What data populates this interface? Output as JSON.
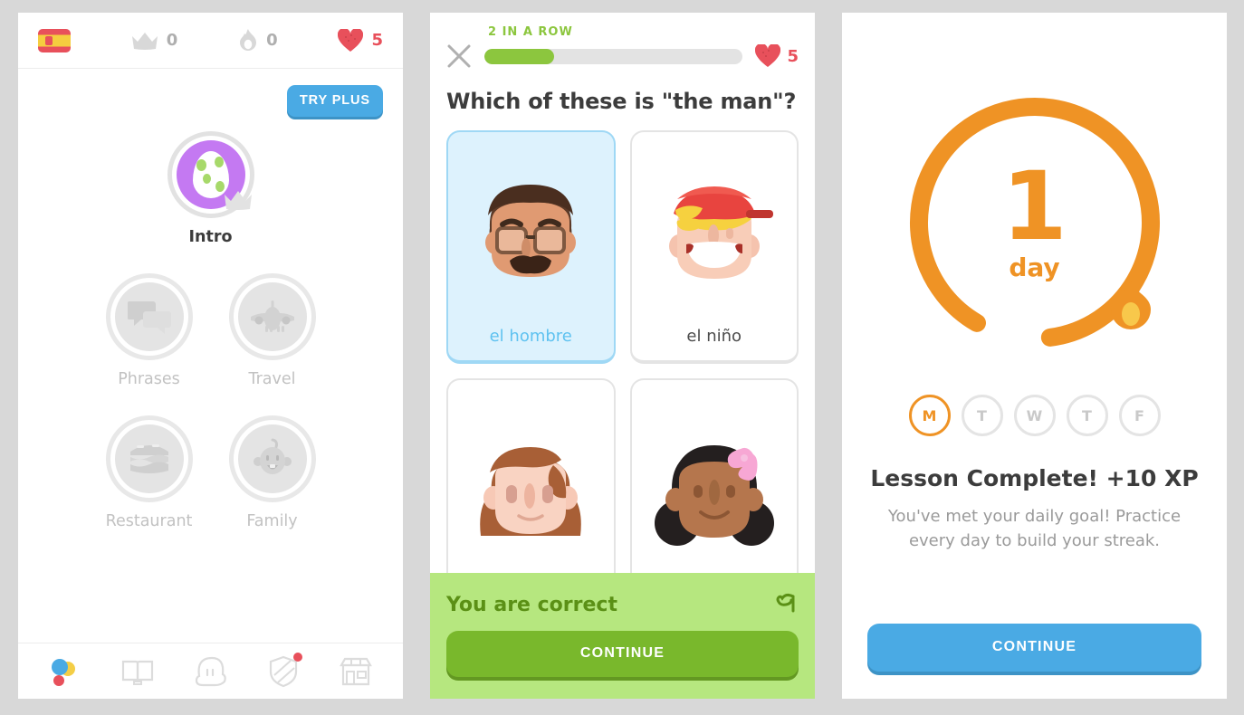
{
  "theme": {
    "page_background": "#d8d8d8",
    "green": "#8cc63e",
    "blue": "#4aaae4",
    "orange": "#ef9325",
    "red": "#e8505b",
    "purple": "#c479f2"
  },
  "home": {
    "topbar": {
      "flag_icon": "spanish-flag-icon",
      "crown_icon": "crown-icon",
      "crown_count": "0",
      "streak_icon": "flame-icon",
      "streak_count": "0",
      "hearts_icon": "heart-icon",
      "hearts_count": "5"
    },
    "try_plus_label": "TRY PLUS",
    "skills": [
      {
        "label": "Intro",
        "icon": "egg-icon",
        "state": "unlocked",
        "crown": true
      },
      {
        "label": "Phrases",
        "icon": "speech-bubbles-icon",
        "state": "locked",
        "crown": false
      },
      {
        "label": "Travel",
        "icon": "airplane-icon",
        "state": "locked",
        "crown": false
      },
      {
        "label": "Restaurant",
        "icon": "burger-icon",
        "state": "locked",
        "crown": false
      },
      {
        "label": "Family",
        "icon": "baby-face-icon",
        "state": "locked",
        "crown": false
      }
    ],
    "nav": [
      {
        "name": "learn",
        "icon": "duolingo-dots-icon",
        "active": true,
        "badge": false
      },
      {
        "name": "stories",
        "icon": "open-book-icon",
        "active": false,
        "badge": false
      },
      {
        "name": "profile",
        "icon": "character-head-icon",
        "active": false,
        "badge": false
      },
      {
        "name": "leagues",
        "icon": "shield-icon",
        "active": false,
        "badge": true
      },
      {
        "name": "shop",
        "icon": "store-icon",
        "active": false,
        "badge": false
      }
    ]
  },
  "lesson": {
    "close_icon": "close-x-icon",
    "streak_label": "2 IN A ROW",
    "progress_percent": 27,
    "hearts_icon": "heart-icon",
    "hearts_count": "5",
    "question": "Which of these is \"the man\"?",
    "choices": [
      {
        "label": "el hombre",
        "art": "man-with-glasses-and-mustache",
        "selected": true
      },
      {
        "label": "el niño",
        "art": "boy-with-red-cap",
        "selected": false
      },
      {
        "label": "",
        "art": "woman-with-brown-hair",
        "selected": false
      },
      {
        "label": "",
        "art": "girl-with-pink-bow",
        "selected": false
      }
    ],
    "feedback": {
      "text": "You are correct",
      "report_icon": "flag-report-icon",
      "continue_label": "CONTINUE"
    }
  },
  "streak_screen": {
    "streak_number": "1",
    "streak_unit": "day",
    "flame_icon": "flame-icon",
    "days": [
      {
        "letter": "M",
        "active": true
      },
      {
        "letter": "T",
        "active": false
      },
      {
        "letter": "W",
        "active": false
      },
      {
        "letter": "T",
        "active": false
      },
      {
        "letter": "F",
        "active": false
      }
    ],
    "title": "Lesson Complete! +10 XP",
    "subtitle": "You've met your daily goal! Practice every day to build your streak.",
    "continue_label": "CONTINUE"
  }
}
